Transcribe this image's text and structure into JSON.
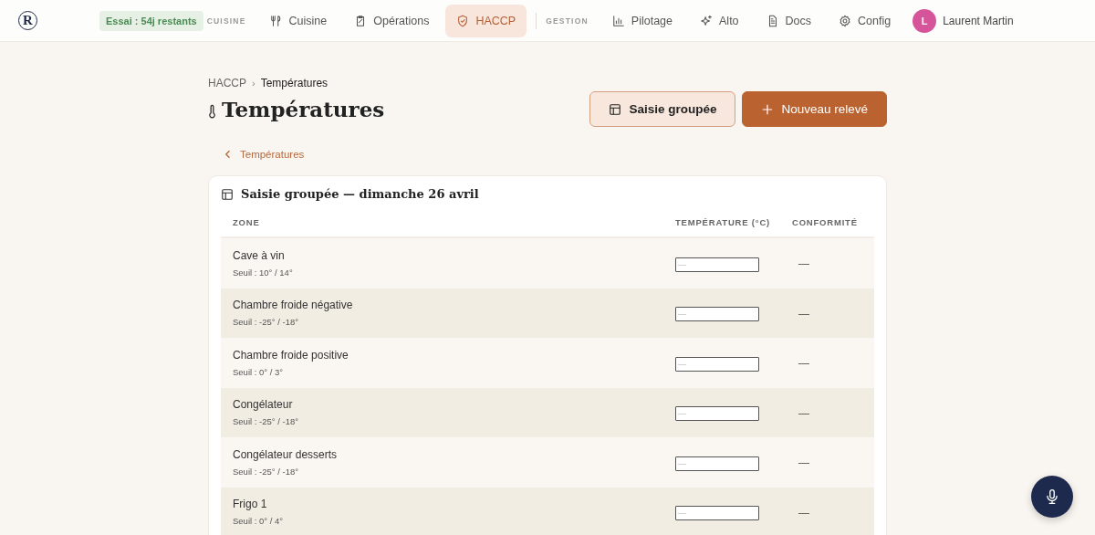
{
  "nav": {
    "logo": "R",
    "trial_badge": "Essai : 54j restants",
    "sections": [
      {
        "label": "CUISINE",
        "items": [
          {
            "label": "Cuisine",
            "selected": false
          },
          {
            "label": "Opérations",
            "selected": false
          },
          {
            "label": "HACCP",
            "selected": true
          }
        ]
      },
      {
        "label": "GESTION",
        "items": [
          {
            "label": "Pilotage",
            "selected": false
          },
          {
            "label": "Alto",
            "selected": false
          },
          {
            "label": "Docs",
            "selected": false
          },
          {
            "label": "Config",
            "selected": false
          }
        ]
      }
    ],
    "user": {
      "initial": "L",
      "name": "Laurent Martin"
    }
  },
  "breadcrumb": {
    "separator": "›",
    "items": [
      "HACCP",
      "Températures"
    ]
  },
  "title": "Températures",
  "actions": {
    "secondary": "Saisie groupée",
    "primary": "Nouveau relevé"
  },
  "back_link": "Températures",
  "card": {
    "title": "Saisie groupée — dimanche 26 avril",
    "columns": [
      "ZONE",
      "TEMPÉRATURE (°C)",
      "CONFORMITÉ"
    ],
    "rows": [
      {
        "zone": "Cave à vin",
        "threshold": "Seuil : 10° / 14°",
        "placeholder": "—",
        "conformity": "—"
      },
      {
        "zone": "Chambre froide négative",
        "threshold": "Seuil : -25° / -18°",
        "placeholder": "—",
        "conformity": "—"
      },
      {
        "zone": "Chambre froide positive",
        "threshold": "Seuil : 0° / 3°",
        "placeholder": "—",
        "conformity": "—"
      },
      {
        "zone": "Congélateur",
        "threshold": "Seuil : -25° / -18°",
        "placeholder": "—",
        "conformity": "—"
      },
      {
        "zone": "Congélateur desserts",
        "threshold": "Seuil : -25° / -18°",
        "placeholder": "—",
        "conformity": "—"
      },
      {
        "zone": "Frigo 1",
        "threshold": "Seuil : 0° / 4°",
        "placeholder": "—",
        "conformity": "—"
      }
    ]
  }
}
